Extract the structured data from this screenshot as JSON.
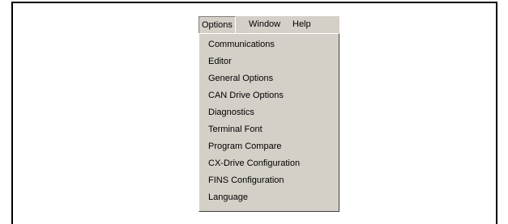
{
  "menubar": {
    "options": "Options",
    "window": "Window",
    "help": "Help"
  },
  "options_menu": {
    "items": [
      "Communications",
      "Editor",
      "General Options",
      "CAN Drive Options",
      "Diagnostics",
      "Terminal Font",
      "Program Compare",
      "CX-Drive Configuration",
      "FINS Configuration",
      "Language"
    ]
  }
}
